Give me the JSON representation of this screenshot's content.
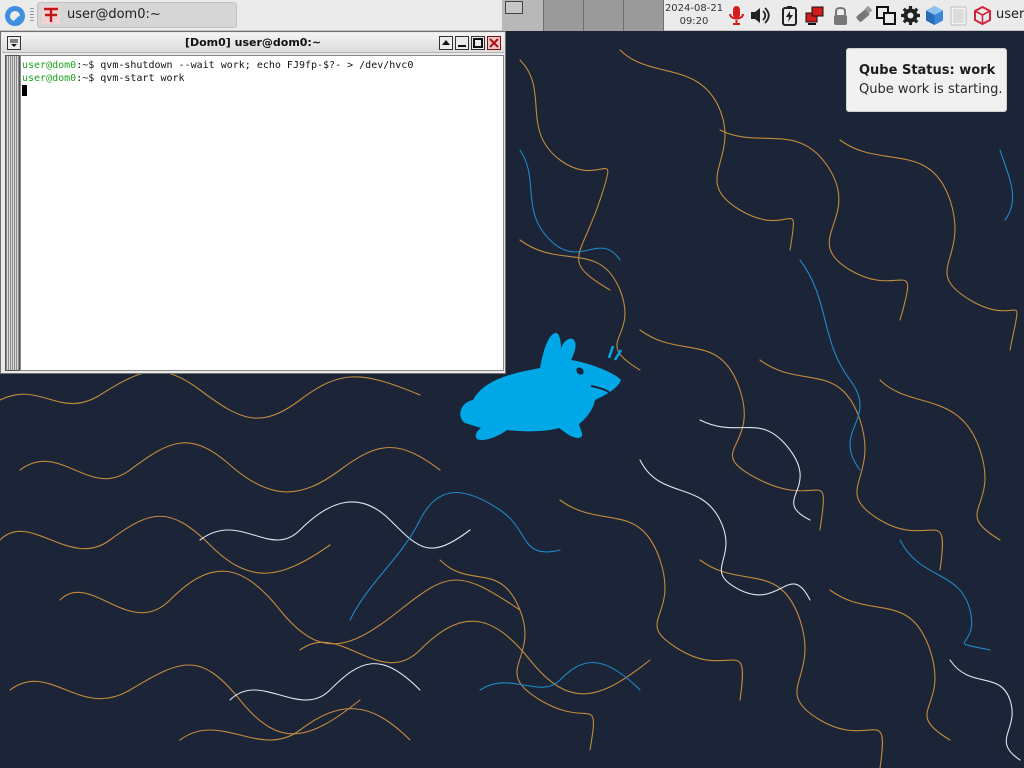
{
  "panel": {
    "menu_icon": "qubes-menu-icon",
    "task": {
      "icon": "terminal-app-icon",
      "label": "user@dom0:~"
    },
    "clock": {
      "date": "2024-08-21",
      "time": "09:20"
    },
    "tray": [
      "microphone-icon",
      "volume-icon",
      "battery-charging-icon",
      "network-devices-icon",
      "lock-icon",
      "usb-device-icon",
      "window-switch-icon",
      "settings-gear-icon",
      "qube-cube-icon",
      "clipboard-icon",
      "qube-updater-icon"
    ],
    "user_label": "user",
    "colors": {
      "panel_bg": "#ebebeb",
      "mic_red": "#d41c1c"
    }
  },
  "terminal": {
    "title": "[Dom0] user@dom0:~",
    "lines": [
      {
        "user": "user@dom0",
        "path": ":~$ ",
        "command": "qvm-shutdown --wait work; echo FJ9fp-$?- > /dev/hvc0"
      },
      {
        "user": "user@dom0",
        "path": ":~$ ",
        "command": "qvm-start work"
      }
    ],
    "colors": {
      "prompt": "#1fa31f",
      "bg": "#ffffff"
    }
  },
  "notification": {
    "title": "Qube Status: work",
    "body": "Qube work is starting."
  },
  "desktop": {
    "colors": {
      "background": "#1b2537",
      "contour_orange": "#c48a3c",
      "contour_blue": "#1e88c8",
      "mascot": "#00a8e8"
    }
  }
}
